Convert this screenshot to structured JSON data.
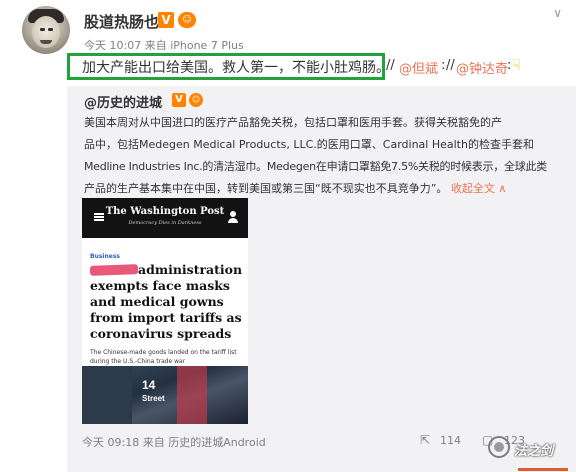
{
  "post": {
    "author": "股道热肠也",
    "time": "今天 10:07",
    "source": "来自 iPhone 7 Plus",
    "text": "加大产能出口给美国。救人第一，不能小肚鸡肠。",
    "slash1": "//",
    "mention1": "@但斌",
    "slash2": ":",
    "slash3": "//",
    "mention2": "@钟达奇",
    "colon_end": ":"
  },
  "repost": {
    "author": "@历史的进城",
    "lines": [
      "美国本周对从中国进口的医疗产品豁免关税，包括口罩和医用手套。获得关税豁免的产",
      "品中，包括Medegen Medical Products, LLC.的医用口罩、Cardinal Health的检查手套和",
      "Medline Industries Inc.的清洁湿巾。Medegen在申请口罩豁免7.5%关税的时候表示，全球此类",
      "产品的生产基本集中在中国，转到美国或第三国“既不现实也不具竞争力”。"
    ],
    "collapse_label": "收起全文 ∧",
    "image": {
      "masthead": "The Washington Post",
      "tagline": "Democracy Dies in Darkness",
      "section": "Business",
      "headline": "administration exempts face masks and medical gowns from import tariffs as coronavirus spreads",
      "caption": "The Chinese-made goods landed on the tariff list during the U.S.-China trade war",
      "street_number": "14",
      "street_name": "Street"
    },
    "time": "今天 09:18",
    "source": "来自 历史的进城Android",
    "share_count": "114",
    "comment_count": "123"
  },
  "watermark": {
    "text": "法之剑"
  },
  "colors": {
    "link": "#eb7350",
    "badge": "#ff8200",
    "highlight_box": "#22a33a"
  },
  "icons": [
    "avatar",
    "verified-v-badge",
    "member-badge",
    "chevron-down-icon",
    "pointing-hand-icon",
    "hamburger-menu-icon",
    "user-icon",
    "share-icon",
    "comment-icon",
    "like-icon",
    "wechat-logo"
  ]
}
